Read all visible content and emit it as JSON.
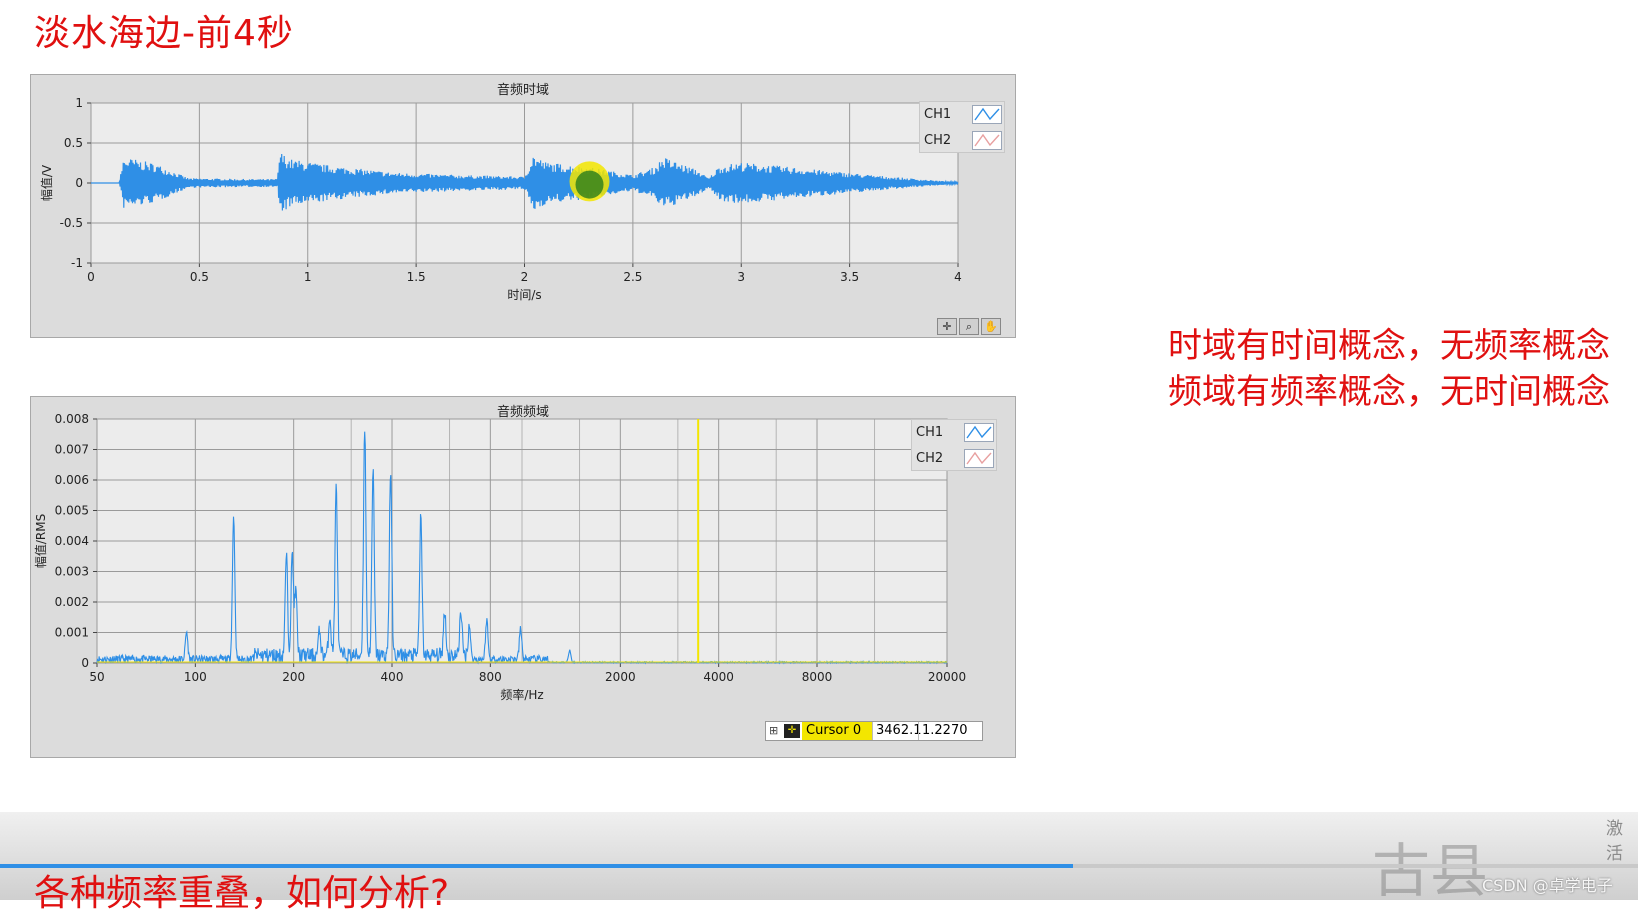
{
  "slide": {
    "title": "淡水海边-前4秒",
    "notes": [
      "时域有时间概念，无频率概念",
      "频域有频率概念，无时间概念"
    ],
    "bottom_heading": "各种频率重叠，如何分析?",
    "watermark": "CSDN @卓学电子",
    "activate_text": "激活",
    "ghost_sign": "古县"
  },
  "colors": {
    "accent_red": "#e01010",
    "ch1": "#2f8fe6",
    "ch2": "#e8a0a0",
    "cursor": "#f3e600",
    "plot_bg": "#ececec"
  },
  "time_chart": {
    "title": "音频时域",
    "legend": [
      "CH1",
      "CH2"
    ],
    "tools": [
      "cursor-tool-icon",
      "zoom-icon",
      "pan-hand-icon"
    ]
  },
  "freq_chart": {
    "title": "音频频域",
    "legend": [
      "CH1",
      "CH2"
    ],
    "cursor": {
      "name": "Cursor 0",
      "x": "3462.1",
      "y": "1.2270"
    }
  },
  "player": {
    "progress": 0.655
  },
  "chart_data": [
    {
      "type": "line",
      "title": "音频时域",
      "xlabel": "时间/s",
      "ylabel": "幅值/V",
      "xlim": [
        0,
        4
      ],
      "ylim": [
        -1,
        1
      ],
      "xticks": [
        "0",
        "0.5",
        "1",
        "1.5",
        "2",
        "2.5",
        "3",
        "3.5",
        "4"
      ],
      "yticks": [
        "1",
        "0.5",
        "0",
        "-0.5",
        "-1"
      ],
      "grid": true,
      "legend_position": "top-right",
      "series": [
        {
          "name": "CH1",
          "envelope": {
            "t": [
              0,
              0.13,
              0.15,
              0.2,
              0.3,
              0.45,
              0.7,
              0.86,
              0.87,
              0.92,
              1.1,
              1.4,
              1.7,
              2.0,
              2.04,
              2.1,
              2.3,
              2.5,
              2.6,
              2.64,
              2.8,
              2.85,
              2.9,
              3.0,
              3.3,
              3.6,
              3.9,
              4.0
            ],
            "amp": [
              0,
              0,
              0.32,
              0.3,
              0.24,
              0.06,
              0.05,
              0.05,
              0.4,
              0.3,
              0.22,
              0.13,
              0.1,
              0.08,
              0.36,
              0.26,
              0.2,
              0.1,
              0.2,
              0.33,
              0.16,
              0.06,
              0.22,
              0.26,
              0.18,
              0.1,
              0.03,
              0.01
            ]
          }
        },
        {
          "name": "CH2",
          "envelope": {
            "t": [],
            "amp": []
          }
        }
      ]
    },
    {
      "type": "line",
      "title": "音频频域",
      "xlabel": "频率/Hz",
      "ylabel": "幅值/RMS",
      "xscale": "log",
      "xlim": [
        50,
        20000
      ],
      "ylim": [
        0,
        0.008
      ],
      "xticks": [
        "50",
        "100",
        "200",
        "400",
        "800",
        "2000",
        "4000",
        "8000",
        "20000"
      ],
      "yticks": [
        "0.008",
        "0.007",
        "0.006",
        "0.005",
        "0.004",
        "0.003",
        "0.002",
        "0.001",
        "0"
      ],
      "grid": true,
      "legend_position": "top-right",
      "cursor_x": 3462.1,
      "series": [
        {
          "name": "CH1",
          "peaks": [
            {
              "f": 94,
              "v": 0.0009
            },
            {
              "f": 131,
              "v": 0.0047
            },
            {
              "f": 190,
              "v": 0.0033
            },
            {
              "f": 198,
              "v": 0.0033
            },
            {
              "f": 203,
              "v": 0.0021
            },
            {
              "f": 240,
              "v": 0.0008
            },
            {
              "f": 258,
              "v": 0.0013
            },
            {
              "f": 270,
              "v": 0.0056
            },
            {
              "f": 330,
              "v": 0.0075
            },
            {
              "f": 350,
              "v": 0.006
            },
            {
              "f": 396,
              "v": 0.0061
            },
            {
              "f": 490,
              "v": 0.0045
            },
            {
              "f": 580,
              "v": 0.0015
            },
            {
              "f": 650,
              "v": 0.0015
            },
            {
              "f": 690,
              "v": 0.001
            },
            {
              "f": 780,
              "v": 0.0013
            },
            {
              "f": 990,
              "v": 0.001
            },
            {
              "f": 1400,
              "v": 0.0004
            }
          ]
        },
        {
          "name": "CH2",
          "peaks": []
        }
      ]
    }
  ]
}
